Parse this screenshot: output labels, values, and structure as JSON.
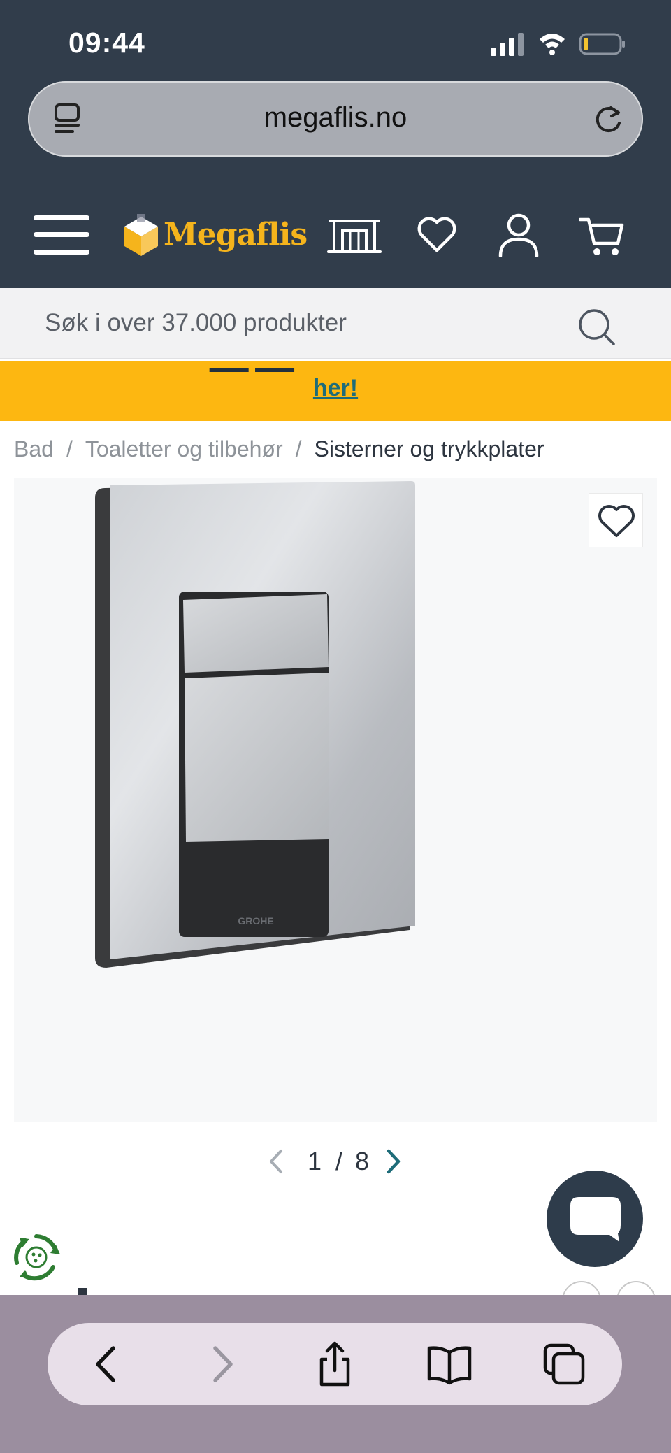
{
  "status_bar": {
    "time": "09:44"
  },
  "browser": {
    "url": "megaflis.no"
  },
  "header": {
    "logo_text": "Megaflis"
  },
  "search": {
    "placeholder": "Søk i over 37.000 produkter"
  },
  "banner": {
    "link_text": "her!",
    "background": "#fdb711"
  },
  "breadcrumb": {
    "items": [
      "Bad",
      "Toaletter og tilbehør",
      "Sisterner og trykkplater"
    ],
    "separator": "/"
  },
  "product_image": {
    "brand_mark": "GROHE"
  },
  "gallery": {
    "current": "1",
    "separator": "/",
    "total": "8"
  },
  "icons": {
    "menu": "hamburger-menu-icon",
    "store": "store-icon",
    "wishlist": "heart-icon",
    "account": "user-icon",
    "cart": "shopping-cart-icon",
    "search": "search-icon",
    "chat": "chat-bubble-icon",
    "eco": "recycle-icon"
  },
  "colors": {
    "header_bg": "#313d4b",
    "brand_yellow": "#f5b41c",
    "link_teal": "#1e6c79"
  }
}
